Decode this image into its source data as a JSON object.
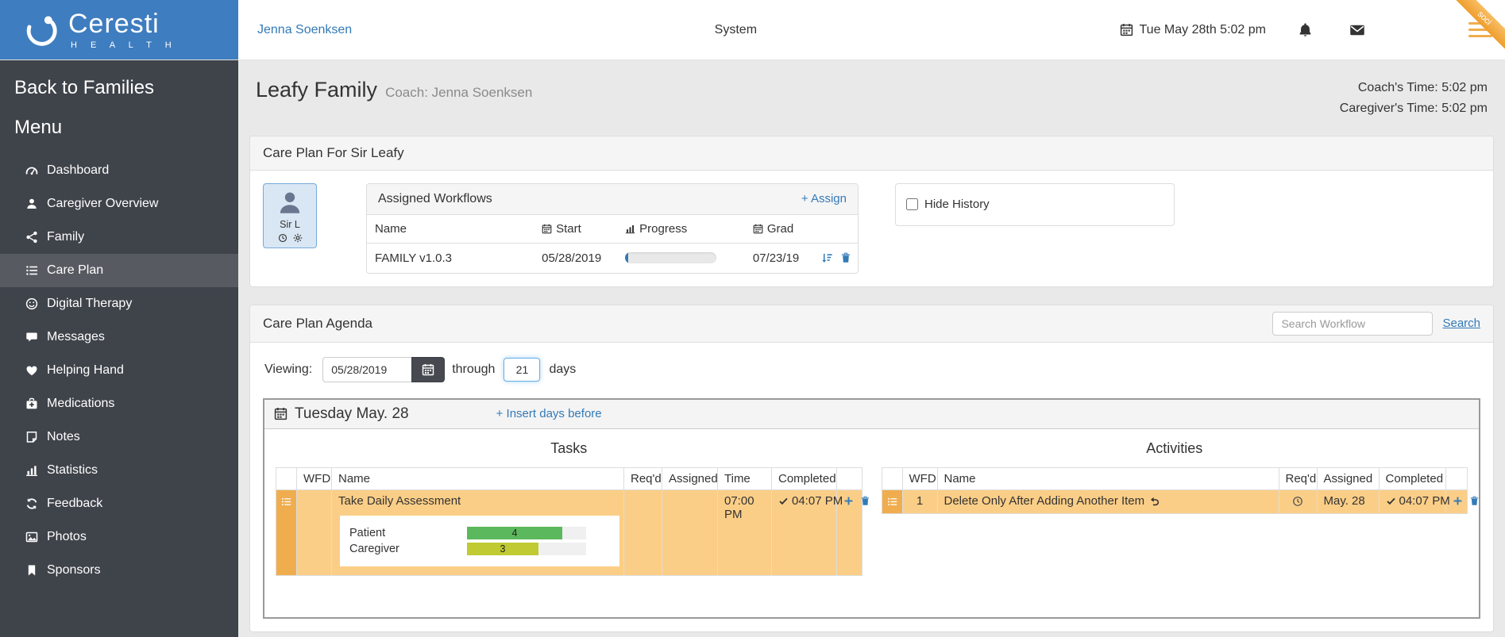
{
  "brand": {
    "name": "Ceresti",
    "tagline": "H E A L T H"
  },
  "topbar": {
    "user": "Jenna Soenksen",
    "center": "System",
    "datetime": "Tue May 28th 5:02 pm",
    "ribbon": "soci"
  },
  "sidebar": {
    "back": "Back to Families",
    "menu": "Menu",
    "items": [
      {
        "label": "Dashboard"
      },
      {
        "label": "Caregiver Overview"
      },
      {
        "label": "Family"
      },
      {
        "label": "Care Plan"
      },
      {
        "label": "Digital Therapy"
      },
      {
        "label": "Messages"
      },
      {
        "label": "Helping Hand"
      },
      {
        "label": "Medications"
      },
      {
        "label": "Notes"
      },
      {
        "label": "Statistics"
      },
      {
        "label": "Feedback"
      },
      {
        "label": "Photos"
      },
      {
        "label": "Sponsors"
      }
    ]
  },
  "page": {
    "family": "Leafy Family",
    "coach": "Coach: Jenna Soenksen",
    "coach_time": "Coach's Time: 5:02 pm",
    "caregiver_time": "Caregiver's Time: 5:02 pm"
  },
  "care_plan": {
    "title": "Care Plan For Sir Leafy",
    "patient_name": "Sir L",
    "workflows": {
      "title": "Assigned Workflows",
      "assign": "+ Assign",
      "cols": {
        "name": "Name",
        "start": "Start",
        "progress": "Progress",
        "grad": "Grad"
      },
      "row": {
        "name": "FAMILY v1.0.3",
        "start": "05/28/2019",
        "progress_pct": 3,
        "grad": "07/23/19"
      }
    },
    "hide_history": "Hide History"
  },
  "agenda": {
    "title": "Care Plan Agenda",
    "search_placeholder": "Search Workflow",
    "search": "Search",
    "viewing": "Viewing:",
    "date": "05/28/2019",
    "through": "through",
    "days_value": "21",
    "days": "days",
    "day": {
      "title": "Tuesday May. 28",
      "insert": "+ Insert days before",
      "tasks": {
        "heading": "Tasks",
        "cols": {
          "wfd": "WFD",
          "name": "Name",
          "reqd": "Req'd",
          "assigned": "Assigned",
          "time": "Time",
          "completed": "Completed"
        },
        "row": {
          "name": "Take Daily Assessment",
          "time": "07:00 PM",
          "completed": "04:07 PM",
          "scores": [
            {
              "label": "Patient",
              "value": 4,
              "max": 5,
              "color": "#5cb85c"
            },
            {
              "label": "Caregiver",
              "value": 3,
              "max": 5,
              "color": "#c0ca33"
            }
          ]
        }
      },
      "activities": {
        "heading": "Activities",
        "cols": {
          "wfd": "WFD",
          "name": "Name",
          "reqd": "Req'd",
          "assigned": "Assigned",
          "completed": "Completed"
        },
        "row": {
          "wfd": "1",
          "name": "Delete Only After Adding Another Item",
          "assigned": "May. 28",
          "completed": "04:07 PM"
        }
      }
    }
  }
}
